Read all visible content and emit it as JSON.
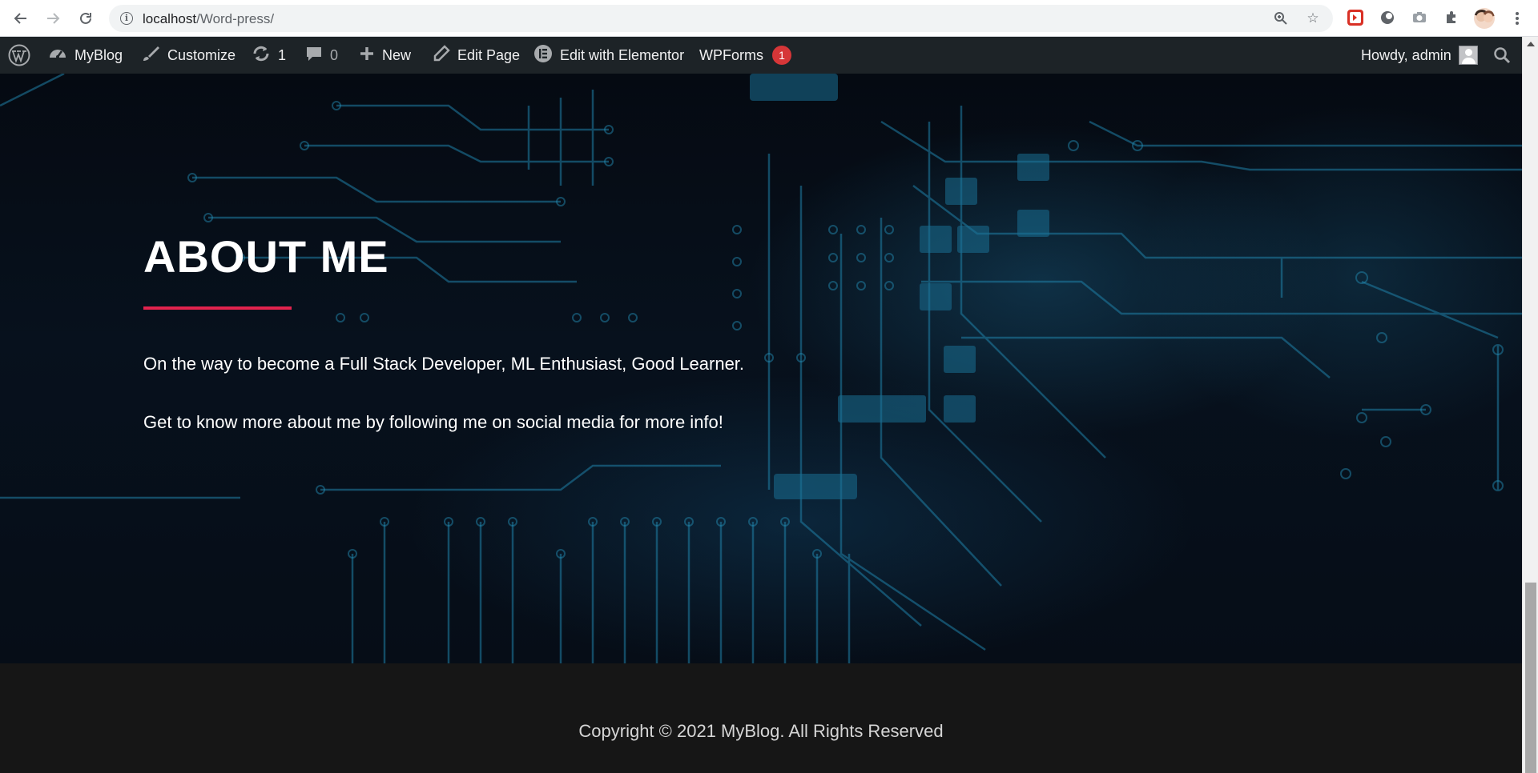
{
  "browser": {
    "url_host": "localhost",
    "url_path": "/Word-press/",
    "icons": [
      "back-icon",
      "forward-icon",
      "reload-icon",
      "info-icon",
      "zoom-icon",
      "star-icon",
      "extensions-icon",
      "menu-icon"
    ]
  },
  "adminbar": {
    "site_name": "MyBlog",
    "customize": "Customize",
    "updates_count": "1",
    "comments_count": "0",
    "new": "New",
    "edit_page": "Edit Page",
    "edit_elementor": "Edit with Elementor",
    "wpforms": "WPForms",
    "wpforms_badge": "1",
    "howdy": "Howdy, admin"
  },
  "hero": {
    "title": "ABOUT ME",
    "line1": "On the way to become a Full Stack Developer, ML Enthusiast, Good Learner.",
    "line2": "Get to know more about me by following me on social media for more info!",
    "accent_color": "#e2234e"
  },
  "footer": {
    "copyright": "Copyright © 2021 MyBlog. All Rights Reserved"
  }
}
